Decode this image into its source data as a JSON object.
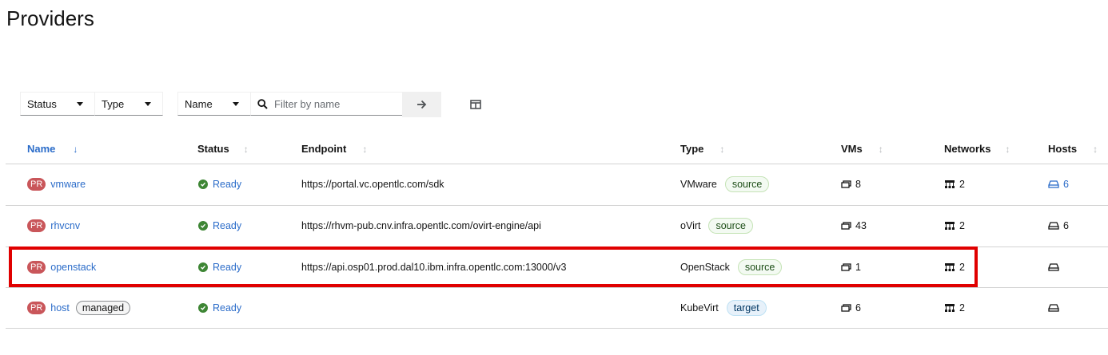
{
  "page": {
    "title": "Providers"
  },
  "toolbar": {
    "status_filter": "Status",
    "type_filter": "Type",
    "name_filter": "Name",
    "search_placeholder": "Filter by name"
  },
  "table": {
    "columns": [
      "Name",
      "Status",
      "Endpoint",
      "Type",
      "VMs",
      "Networks",
      "Hosts"
    ],
    "sorted_column": "Name",
    "rows": [
      {
        "badge": "PR",
        "name": "vmware",
        "tag": "",
        "status": "Ready",
        "endpoint": "https://portal.vc.opentlc.com/sdk",
        "type": "VMware",
        "role": "source",
        "vms": "8",
        "networks": "2",
        "hosts": "6",
        "hosts_link": true
      },
      {
        "badge": "PR",
        "name": "rhvcnv",
        "tag": "",
        "status": "Ready",
        "endpoint": "https://rhvm-pub.cnv.infra.opentlc.com/ovirt-engine/api",
        "type": "oVirt",
        "role": "source",
        "vms": "43",
        "networks": "2",
        "hosts": "6",
        "hosts_link": false
      },
      {
        "badge": "PR",
        "name": "openstack",
        "tag": "",
        "status": "Ready",
        "endpoint": "https://api.osp01.prod.dal10.ibm.infra.opentlc.com:13000/v3",
        "type": "OpenStack",
        "role": "source",
        "vms": "1",
        "networks": "2",
        "hosts": "",
        "hosts_link": false
      },
      {
        "badge": "PR",
        "name": "host",
        "tag": "managed",
        "status": "Ready",
        "endpoint": "",
        "type": "KubeVirt",
        "role": "target",
        "vms": "6",
        "networks": "2",
        "hosts": "",
        "hosts_link": false
      }
    ]
  },
  "colors": {
    "link": "#2b6cc9",
    "ready": "#3e8635",
    "badge": "#c9565a",
    "highlight": "#e00000"
  }
}
